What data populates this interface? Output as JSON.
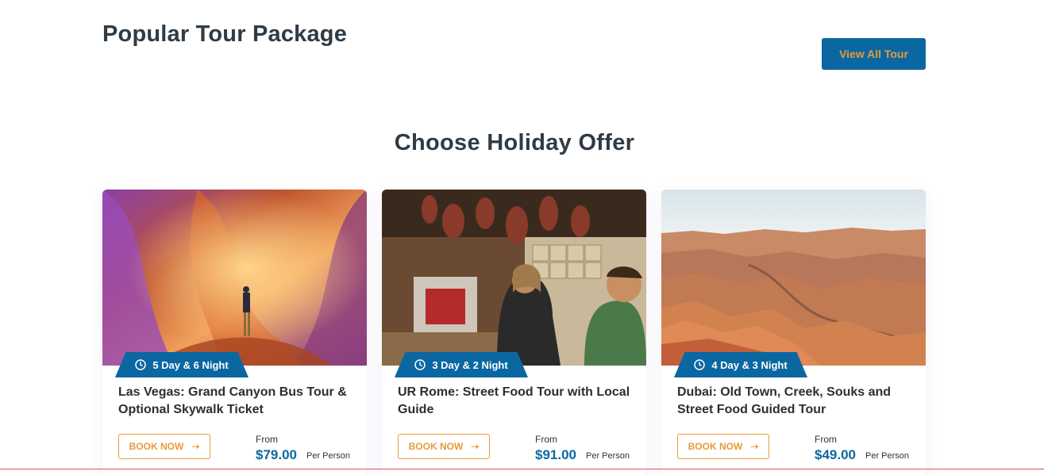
{
  "header": {
    "title": "Popular Tour Package",
    "view_all_label": "View All Tour"
  },
  "section": {
    "title": "Choose Holiday Offer"
  },
  "colors": {
    "primary": "#0b67a2",
    "accent": "#e89a3c",
    "heading": "#2f3b45"
  },
  "cards": [
    {
      "image": "Antelope Canyon slot canyon with hiker",
      "duration_icon": "clock-icon",
      "duration": "5 Day & 6 Night",
      "title": "Las Vegas: Grand Canyon Bus Tour & Optional Skywalk Ticket",
      "book_label": "BOOK NOW",
      "book_icon": "arrow-right-icon",
      "from_label": "From",
      "price": "$79.00",
      "per_person": "Per Person"
    },
    {
      "image": "Woman and boy in Roman deli with hanging hams",
      "duration_icon": "clock-icon",
      "duration": "3 Day & 2 Night",
      "title": "UR Rome: Street Food Tour with Local Guide",
      "book_label": "BOOK NOW",
      "book_icon": "arrow-right-icon",
      "from_label": "From",
      "price": "$91.00",
      "per_person": "Per Person"
    },
    {
      "image": "Grand Canyon landscape with red rocks",
      "duration_icon": "clock-icon",
      "duration": "4 Day & 3 Night",
      "title": "Dubai: Old Town, Creek, Souks and Street Food Guided Tour",
      "book_label": "BOOK NOW",
      "book_icon": "arrow-right-icon",
      "from_label": "From",
      "price": "$49.00",
      "per_person": "Per Person"
    }
  ]
}
